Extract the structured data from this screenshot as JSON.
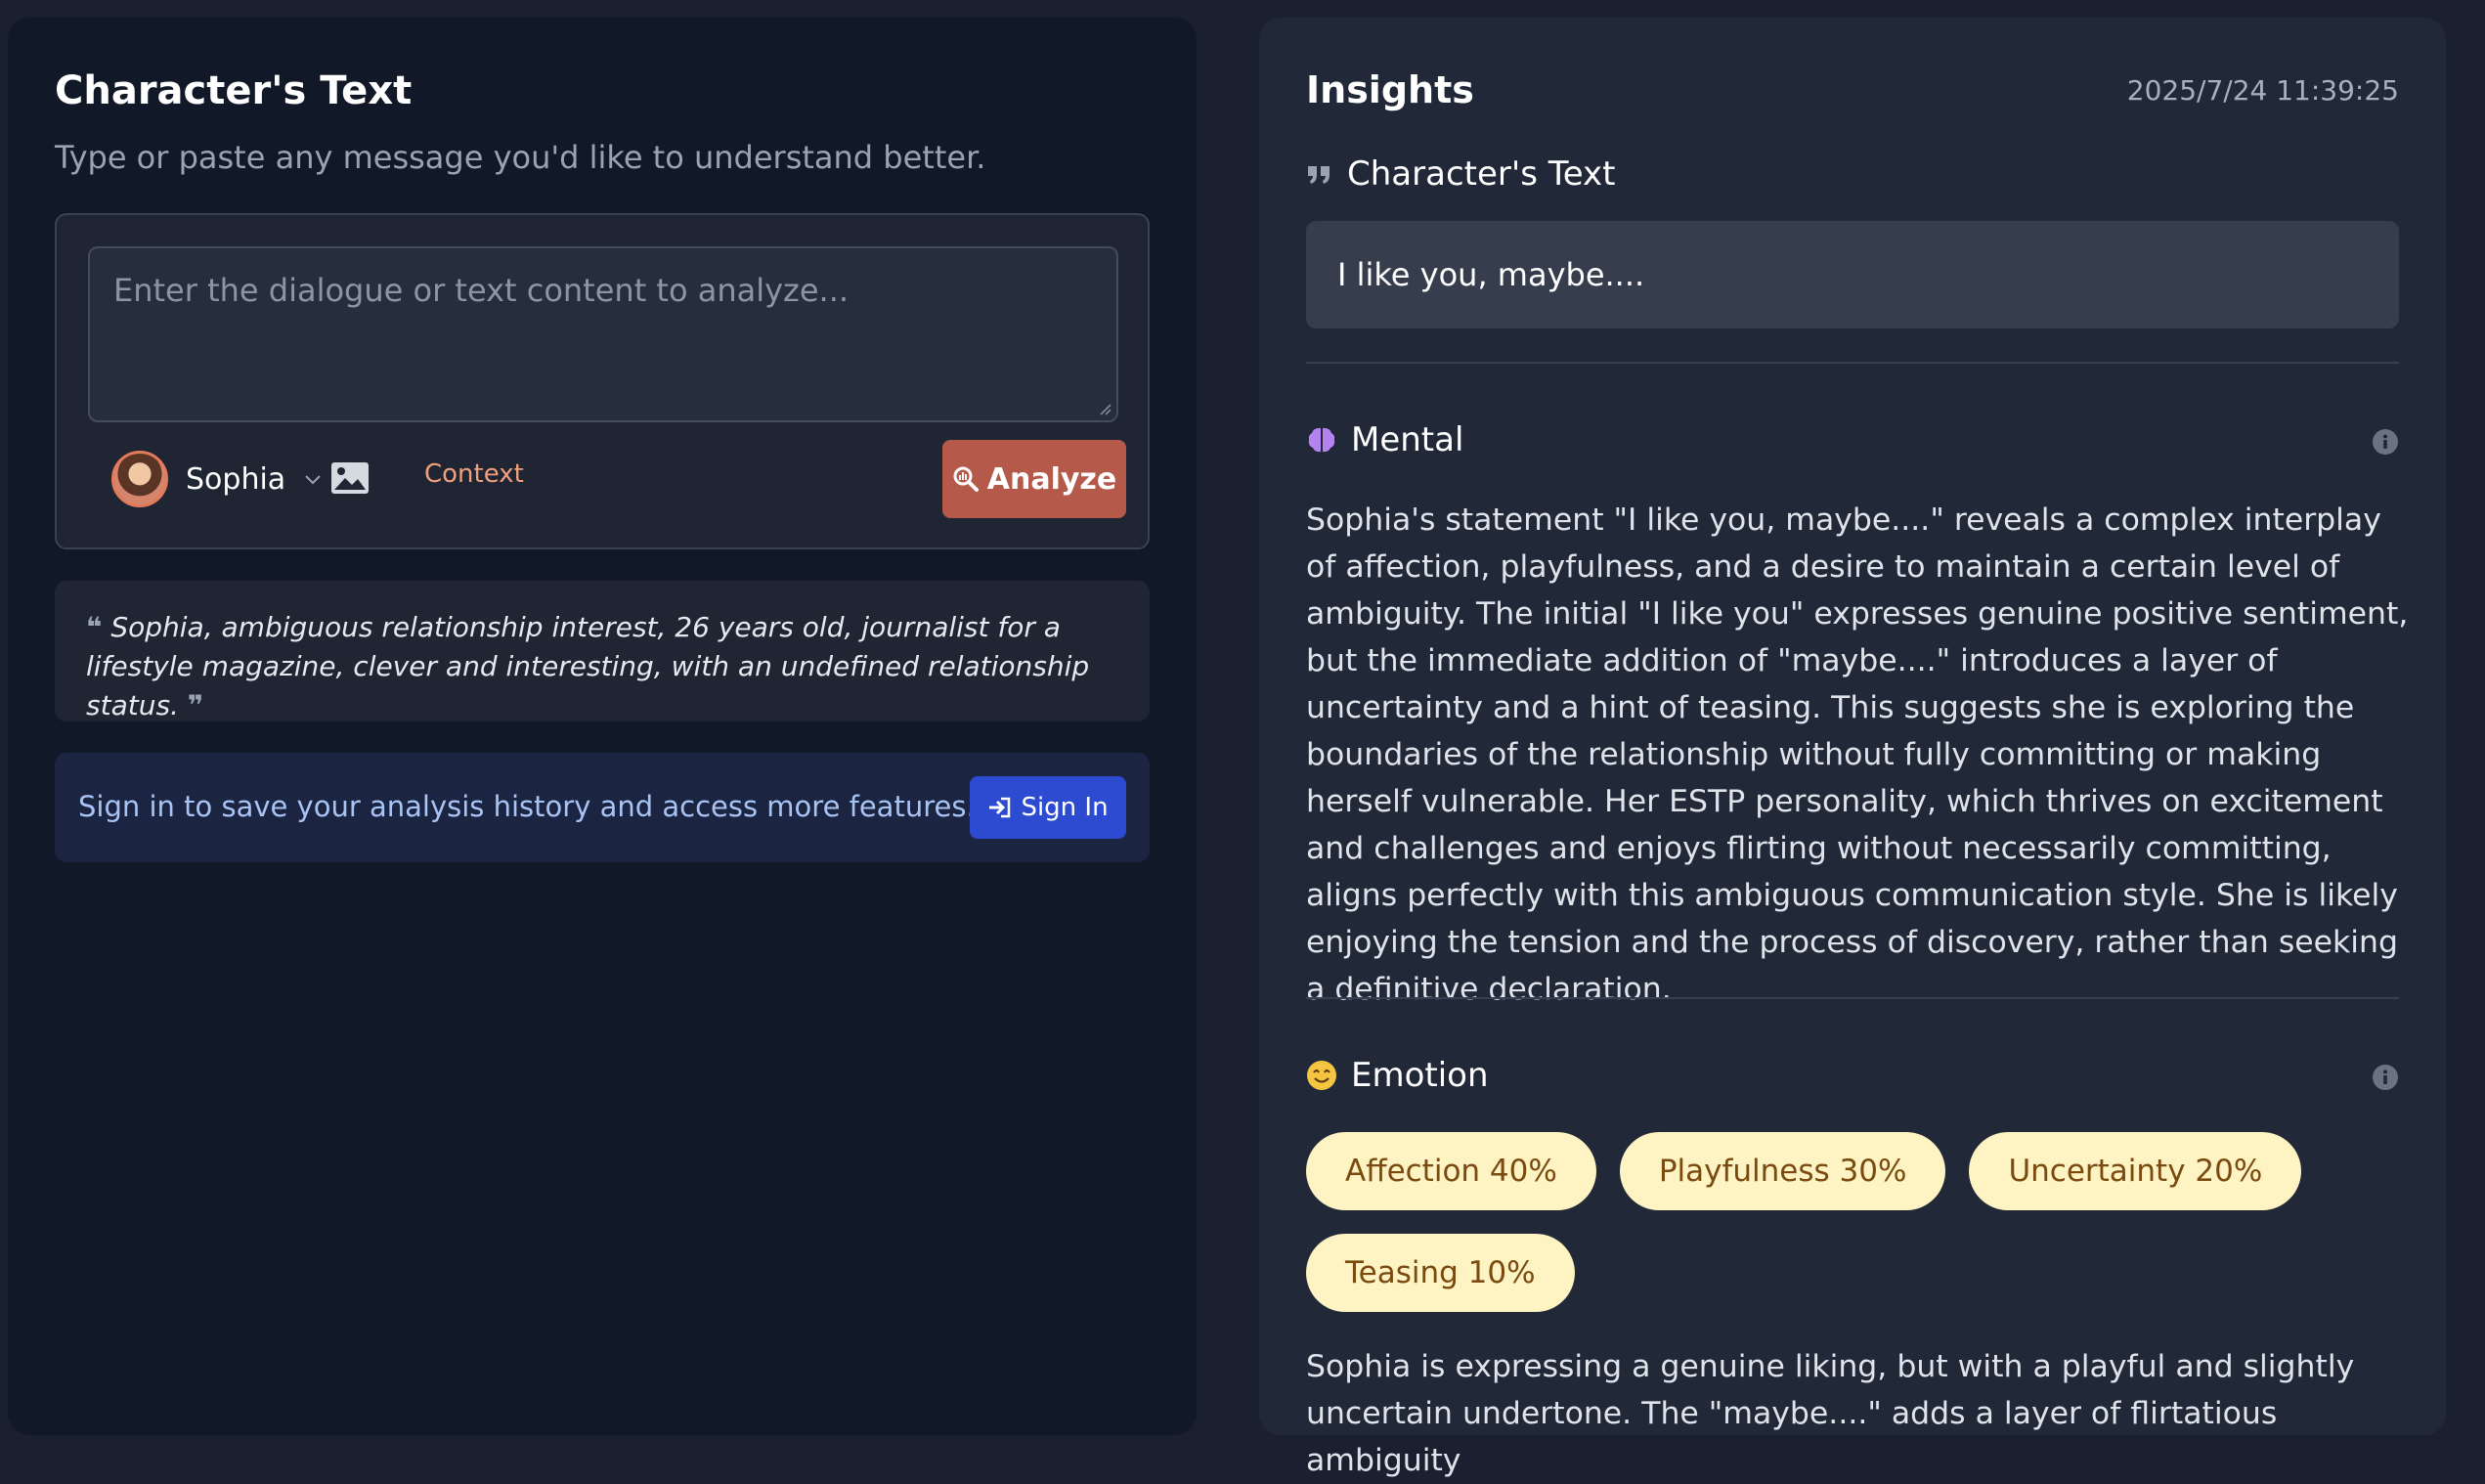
{
  "input_panel": {
    "title": "Character's Text",
    "subtitle": "Type or paste any message you'd like to understand better.",
    "textarea_placeholder": "Enter the dialogue or text content to analyze...",
    "character_name": "Sophia",
    "context_label": "Context",
    "analyze_label": "Analyze",
    "character_description": "Sophia, ambiguous relationship interest, 26 years old, journalist for a lifestyle magazine, clever and interesting, with an undefined relationship status.",
    "signin_prompt": "Sign in to save your analysis history and access more features.",
    "signin_label": "Sign In"
  },
  "insights": {
    "title": "Insights",
    "timestamp": "2025/7/24 11:39:25",
    "quote_section_title": "Character's Text",
    "quote_text": "I like you, maybe....",
    "mental": {
      "title": "Mental",
      "body": "Sophia's statement \"I like you, maybe....\" reveals a complex interplay of affection, playfulness, and a desire to maintain a certain level of ambiguity. The initial \"I like you\" expresses genuine positive sentiment, but the immediate addition of \"maybe....\" introduces a layer of uncertainty and a hint of teasing. This suggests she is exploring the boundaries of the relationship without fully committing or making herself vulnerable. Her ESTP personality, which thrives on excitement and challenges and enjoys flirting without necessarily committing, aligns perfectly with this ambiguous communication style. She is likely enjoying the tension and the process of discovery, rather than seeking a definitive declaration."
    },
    "emotion": {
      "title": "Emotion",
      "chips": [
        "Affection 40%",
        "Playfulness 30%",
        "Uncertainty 20%",
        "Teasing 10%"
      ],
      "body": "Sophia is expressing a genuine liking, but with a playful and slightly uncertain undertone. The \"maybe....\" adds a layer of flirtatious ambiguity"
    }
  },
  "colors": {
    "accent_analyze": "#b55a4a",
    "accent_signin": "#2c4bd0",
    "chip_bg": "#fef3c2",
    "chip_text": "#7a4a10"
  }
}
